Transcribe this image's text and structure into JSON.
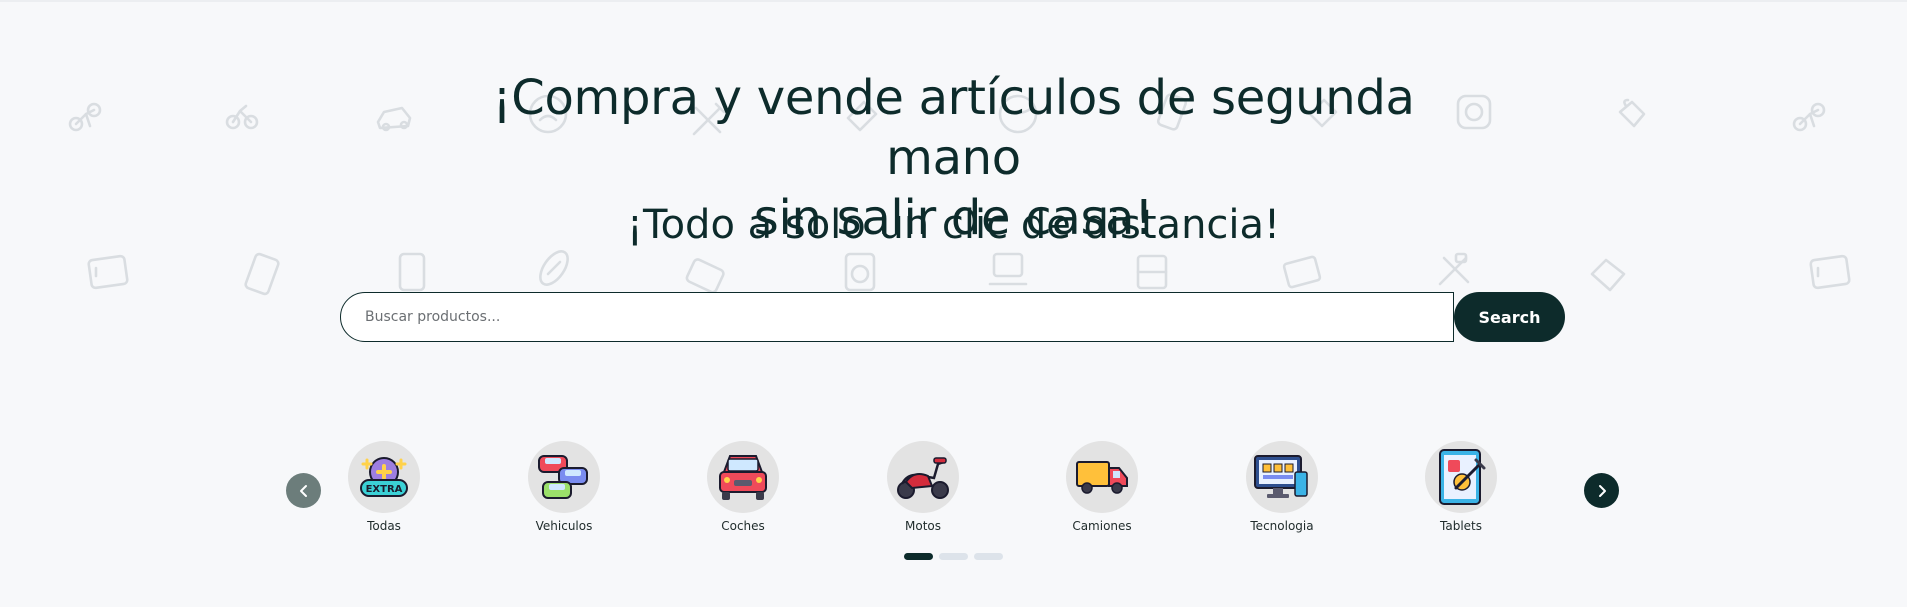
{
  "hero": {
    "title_line1": "¡Compra y vende artículos de segunda mano",
    "title_line2": "sin salir de casa!",
    "subtitle": "¡Todo a solo un clic de distancia!"
  },
  "search": {
    "placeholder": "Buscar productos...",
    "value": "",
    "button_label": "Search"
  },
  "carousel": {
    "prev_icon": "chevron-left-icon",
    "next_icon": "chevron-right-icon",
    "categories": [
      {
        "label": "Todas",
        "icon": "extra-badge-icon"
      },
      {
        "label": "Vehiculos",
        "icon": "stacked-cars-icon"
      },
      {
        "label": "Coches",
        "icon": "car-icon"
      },
      {
        "label": "Motos",
        "icon": "scooter-icon"
      },
      {
        "label": "Camiones",
        "icon": "truck-icon"
      },
      {
        "label": "Tecnologia",
        "icon": "computer-icon"
      },
      {
        "label": "Tablets",
        "icon": "tablet-icon"
      }
    ],
    "pages": 3,
    "active_page": 1
  },
  "colors": {
    "primary": "#0d2b2b",
    "background": "#f7f8fa",
    "icon_circle": "#e3e3e3",
    "dot_inactive": "#dde3ea",
    "prev_arrow": "#6c7d7b"
  }
}
